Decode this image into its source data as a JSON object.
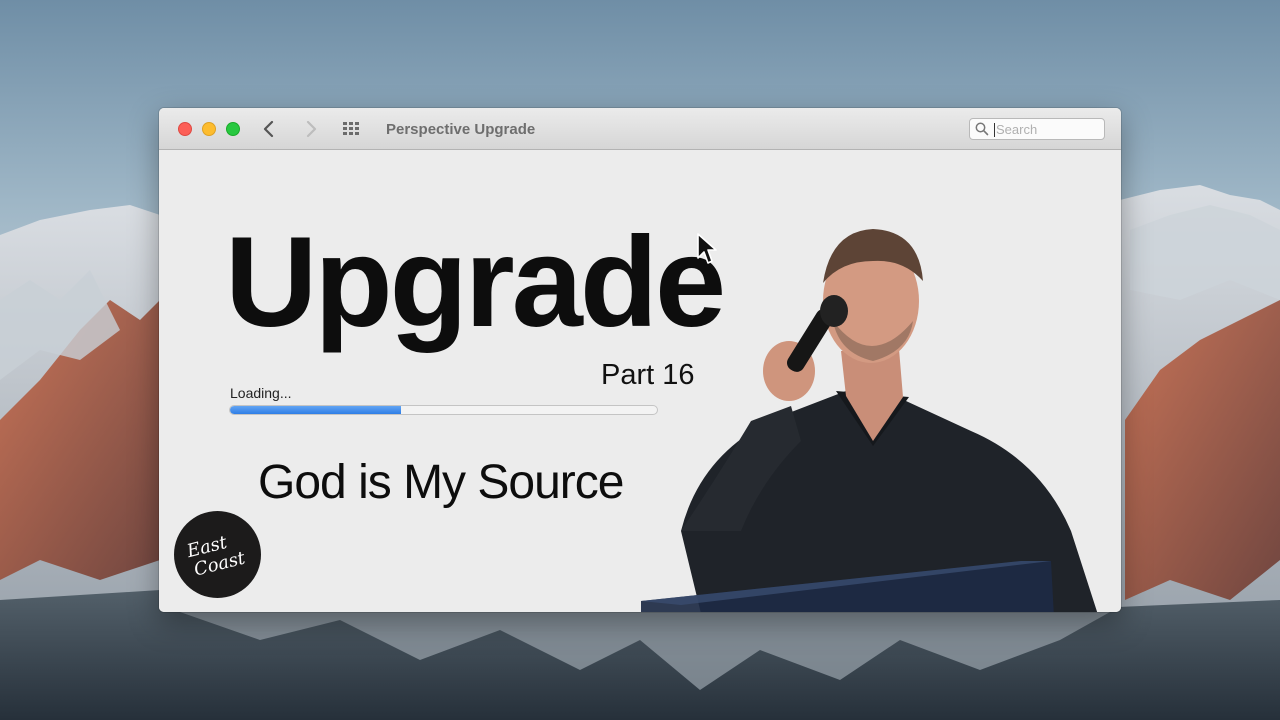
{
  "window": {
    "title": "Perspective Upgrade",
    "search_placeholder": "Search"
  },
  "slide": {
    "headline": "Upgrade",
    "part": "Part 16",
    "loading_label": "Loading...",
    "progress": 0.4,
    "subtitle": "God is My Source",
    "logo_text_line1": "East",
    "logo_text_line2": "Coast"
  },
  "icons": {
    "back": "chevron-left-icon",
    "forward": "chevron-right-icon",
    "grid": "grid-icon",
    "search": "search-icon",
    "cursor": "mouse-pointer-icon"
  },
  "colors": {
    "close": "#fc5f57",
    "minimize": "#fdbc2e",
    "maximize": "#28c840",
    "progress": "#3b87ea",
    "logo_bg": "#1c1b1b"
  }
}
